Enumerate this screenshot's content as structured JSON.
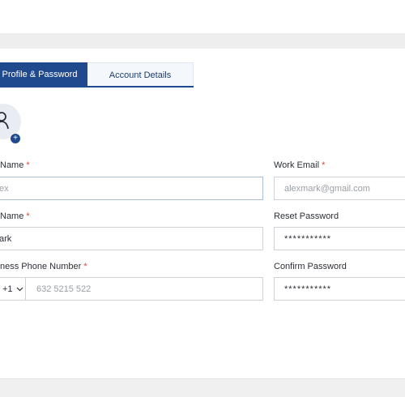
{
  "tabs": [
    {
      "label": "Profile & Password",
      "active": true
    },
    {
      "label": "Account Details",
      "active": false
    }
  ],
  "form": {
    "first_name": {
      "label": "Name",
      "required_mark": "*",
      "value": "",
      "placeholder": "ex"
    },
    "last_name": {
      "label": "Name",
      "required_mark": "*",
      "value": "ark"
    },
    "business_phone": {
      "label": "ness Phone Number",
      "required_mark": "*",
      "country_code": "+1",
      "value": "",
      "placeholder": "632 5215 522"
    },
    "work_email": {
      "label": "Work Email",
      "required_mark": "*",
      "value": "",
      "placeholder": "alexmark@gmail.com"
    },
    "reset_password": {
      "label": "Reset Password",
      "value": "***********"
    },
    "confirm_password": {
      "label": "Confirm Password",
      "value": "***********"
    }
  },
  "avatar": {
    "add_symbol": "+"
  },
  "colors": {
    "accent": "#1f4b8e",
    "required": "#e0453a",
    "tab_inactive_bg": "#f4f8fd"
  },
  "icons": [
    "user-icon",
    "plus-icon",
    "chevron-down-icon"
  ]
}
